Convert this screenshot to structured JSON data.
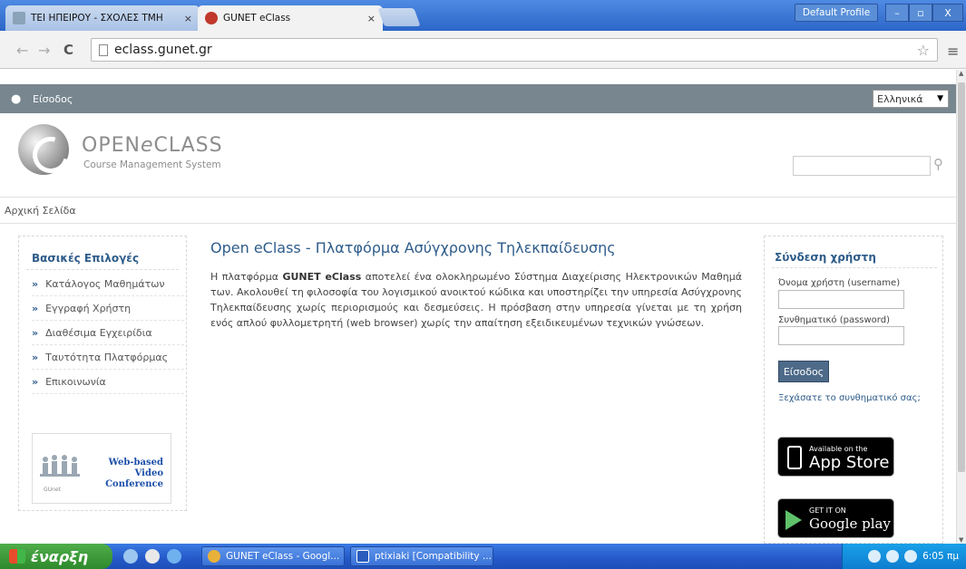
{
  "browser": {
    "tabs": [
      {
        "label": "ΤΕΙ ΗΠΕΙΡΟΥ - ΣΧΟΛΕΣ ΤΜΗ",
        "active": false
      },
      {
        "label": "GUNET eClass",
        "active": true
      }
    ],
    "profile_label": "Default Profile",
    "url": "eclass.gunet.gr"
  },
  "site": {
    "login_link": "Είσοδος",
    "language": "Ελληνικά",
    "logo_text_open": "OPEN",
    "logo_text_e": "e",
    "logo_text_class": "CLASS",
    "logo_sub": "Course Management System",
    "search_placeholder": "",
    "breadcrumb": "Αρχική Σελίδα"
  },
  "left_menu": {
    "title": "Βασικές Επιλογές",
    "items": [
      "Κατάλογος Μαθημάτων",
      "Εγγραφή Χρήστη",
      "Διαθέσιμα Εγχειρίδια",
      "Ταυτότητα Πλατφόρμας",
      "Επικοινωνία"
    ],
    "banner_line1": "Web-based",
    "banner_line2": "Video Conference",
    "banner_small": "GUnet"
  },
  "main": {
    "title": "Open eClass - Πλατφόρμα Ασύγχρονης Τηλεκπαίδευσης",
    "text_before": "Η πλατφόρμα ",
    "text_bold": "GUNET eClass",
    "text_after": " αποτελεί ένα ολοκληρωμένο Σύστημα Διαχείρισης Ηλεκτρονικών Μαθημά των. Ακολουθεί τη φιλοσοφία του λογισμικού ανοικτού κώδικα και υποστηρίζει την υπηρεσία Ασύγχρονης Τηλεκπαίδευσης χωρίς περιορισμούς και δεσμεύσεις. Η πρόσβαση στην υπηρεσία γίνεται με τη χρήση ενός απλού φυλλομετρητή (web browser) χωρίς την απαίτηση εξειδικευμένων τεχνικών γνώσεων."
  },
  "login": {
    "title": "Σύνδεση χρήστη",
    "username_label": "Όνομα χρήστη (username)",
    "password_label": "Συνθηματικό (password)",
    "button": "Είσοδος",
    "forgot": "Ξεχάσατε το συνθηματικό σας;",
    "appstore_small": "Available on the",
    "appstore_big": "App Store",
    "play_small": "GET IT ON",
    "play_big": "Google play"
  },
  "taskbar": {
    "start": "έναρξη",
    "tasks": [
      "GUNET eClass - Googl...",
      "ptixiaki [Compatibility ..."
    ],
    "clock": "6:05 πμ"
  },
  "colors": {
    "accent": "#2e5c8a",
    "userbar": "#77868f",
    "taskbar": "#2458c8",
    "start_button": "#2e8a2c"
  }
}
